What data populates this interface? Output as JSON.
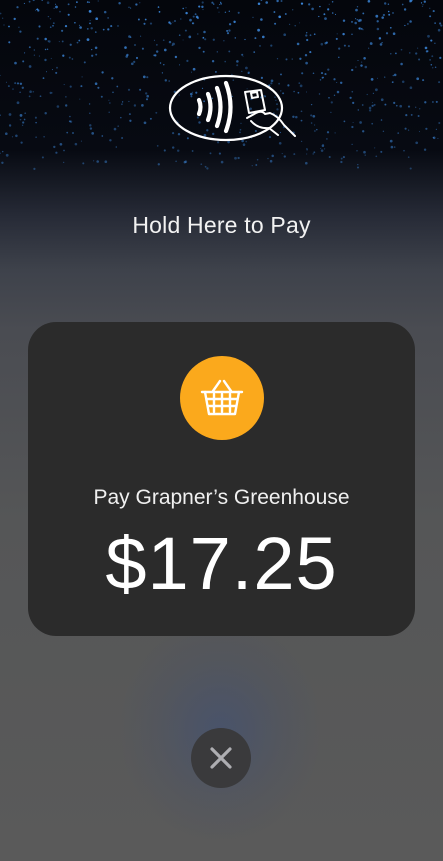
{
  "header": {
    "title": "Hold Here to Pay",
    "icon": "contactless-pay-icon"
  },
  "payment": {
    "merchant_label": "Pay Grapner’s Greenhouse",
    "amount": "$17.25",
    "merchant_icon": "shopping-basket-icon",
    "merchant_icon_color": "#FBA91C"
  },
  "actions": {
    "cancel_icon": "close-icon"
  },
  "colors": {
    "card_background": "#2B2B2B",
    "star_color": "#3F8FE8",
    "cancel_button_background": "#3A3A3C"
  }
}
